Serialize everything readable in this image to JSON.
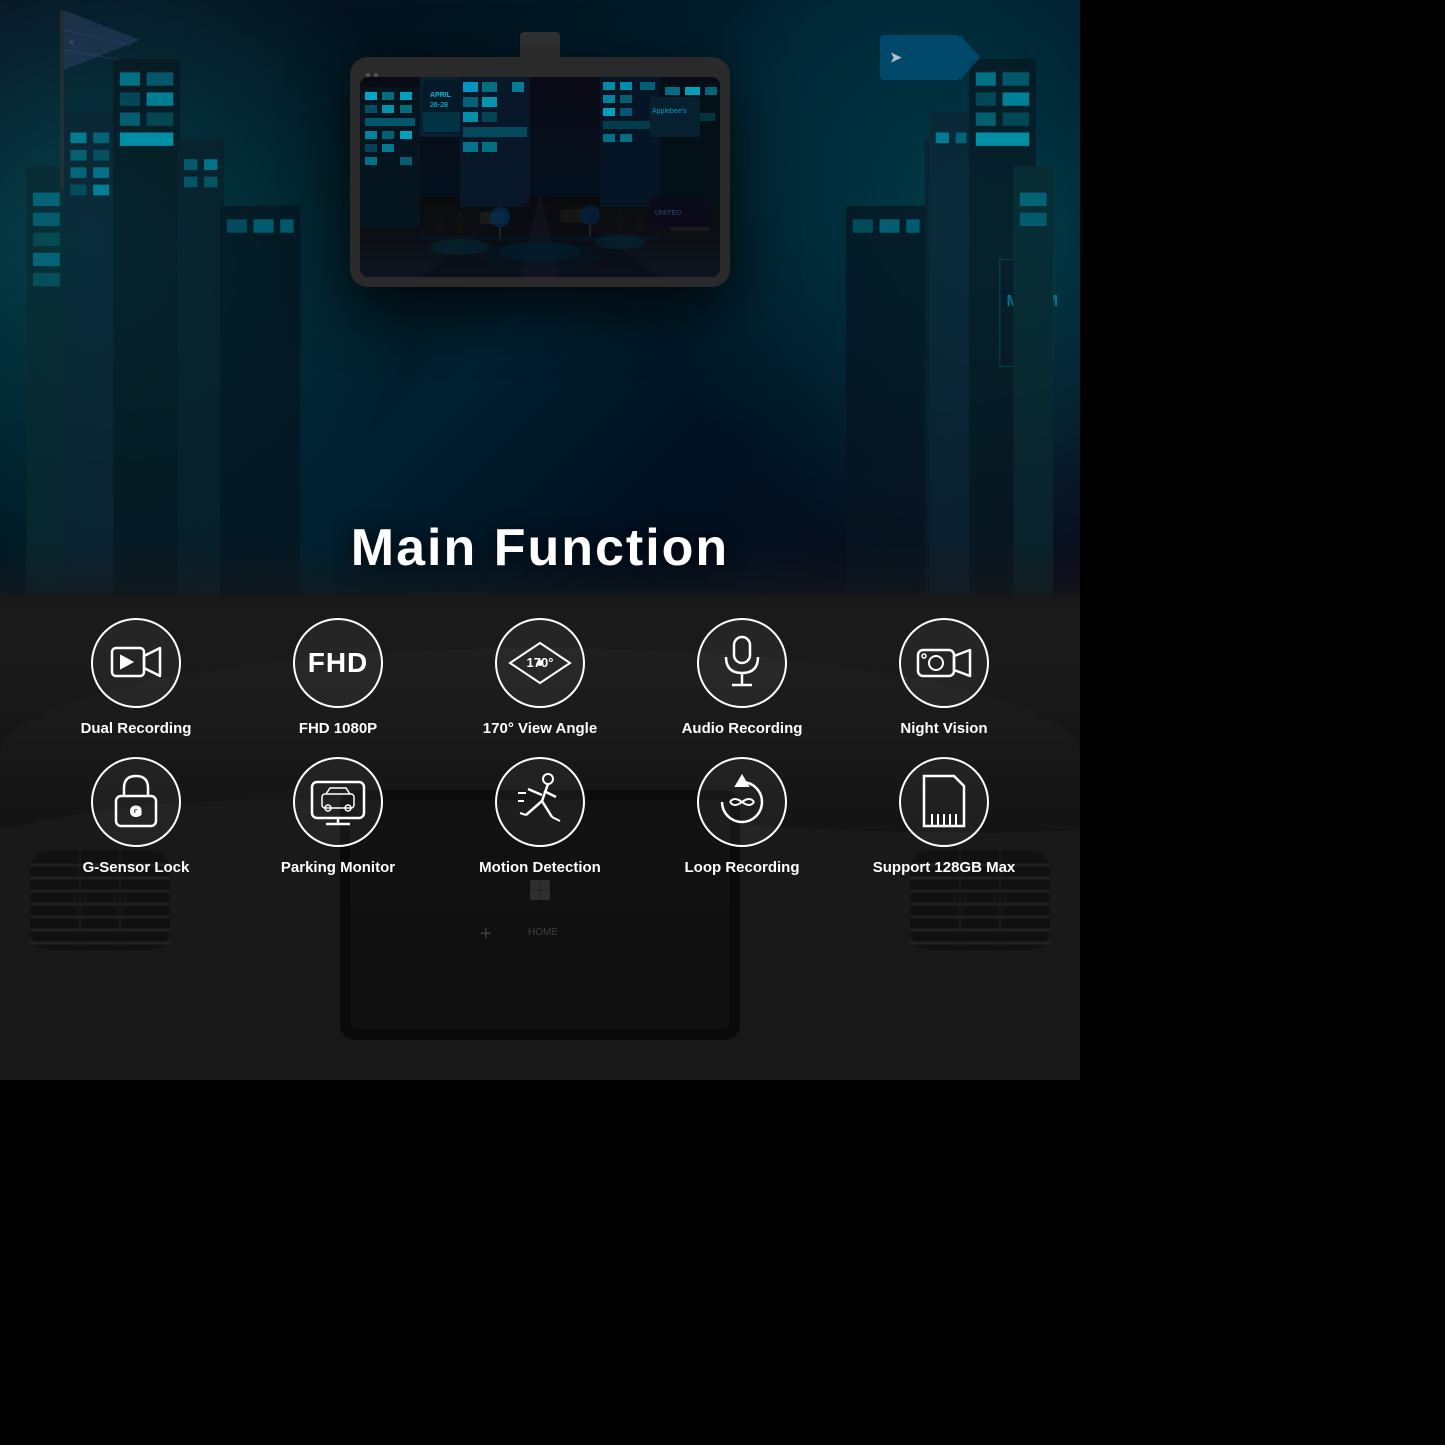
{
  "page": {
    "title": "Main Function",
    "background": {
      "topColor": "#001a2e",
      "bottomColor": "#111111"
    }
  },
  "features": {
    "row1": [
      {
        "id": "dual-recording",
        "label": "Dual Recording",
        "icon": "video-camera"
      },
      {
        "id": "fhd-1080p",
        "label": "FHD 1080P",
        "icon": "fhd-text",
        "display": "FHD"
      },
      {
        "id": "view-angle",
        "label": "170° View Angle",
        "icon": "angle",
        "display": "170°"
      },
      {
        "id": "audio-recording",
        "label": "Audio Recording",
        "icon": "microphone"
      },
      {
        "id": "night-vision",
        "label": "Night Vision",
        "icon": "night-camera"
      }
    ],
    "row2": [
      {
        "id": "g-sensor-lock",
        "label": "G-Sensor Lock",
        "icon": "lock"
      },
      {
        "id": "parking-monitor",
        "label": "Parking Monitor",
        "icon": "screen"
      },
      {
        "id": "motion-detection",
        "label": "Motion Detection",
        "icon": "running-person"
      },
      {
        "id": "loop-recording",
        "label": "Loop Recording",
        "icon": "loop"
      },
      {
        "id": "storage",
        "label": "Support 128GB Max",
        "icon": "sd-card"
      }
    ]
  }
}
